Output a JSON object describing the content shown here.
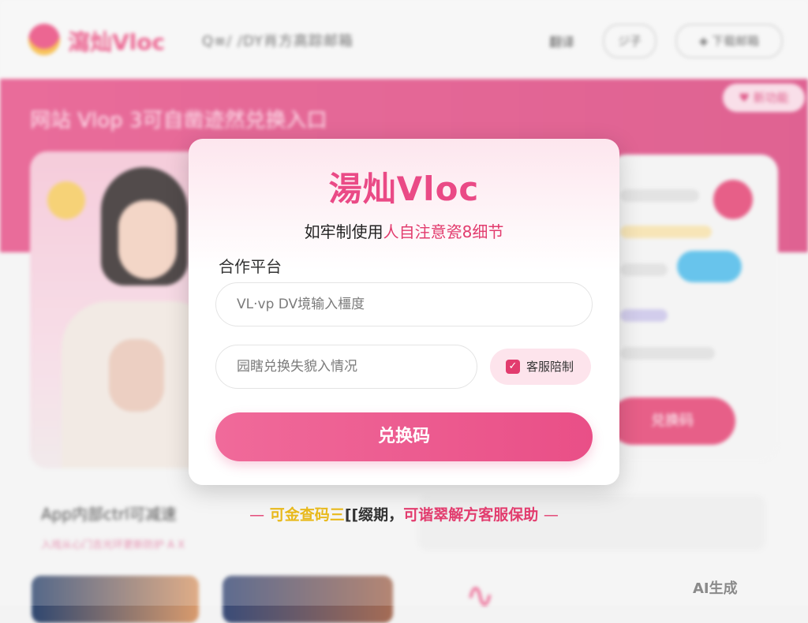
{
  "background": {
    "logo_text": "瀉灿Vloc",
    "search_text": "Q≡/ /DY肖方高踪邮箱",
    "nav_link": "翻译",
    "nav_button_a": "ジ子",
    "nav_button_b": "◈ 下载邮箱",
    "banner_title": "网站 Vlop 3可自凿迹然兑换入口",
    "banner_badge": "♥ 新功能",
    "cta_button": "兑换码",
    "section_title": "App内部ctrl可减速",
    "section_subtitle": "入戏从心门吉光环更新防护 A X",
    "watermark": "AI生成"
  },
  "modal": {
    "title": "湯灿Vloc",
    "subtitle_normal": "如牢制使用",
    "subtitle_highlight": "人自注意瓷8细节",
    "field_label": "合作平台",
    "input1_placeholder": "VL·vp DV境输入橿度",
    "input2_placeholder": "园瞎兑换失貌入情况",
    "checkbox_label": "客服陪制",
    "checkbox_checked": true,
    "submit_label": "兑换码"
  },
  "notice": {
    "dash_left": "—",
    "part_yellow": "可金查码三",
    "part_dark": "[[缀期，",
    "part_pink": "可谐翠解方客服保助",
    "dash_right": "—"
  },
  "colors": {
    "accent": "#e94f87",
    "brand_pink": "#e23c6e",
    "highlight_yellow": "#e8b91c"
  }
}
